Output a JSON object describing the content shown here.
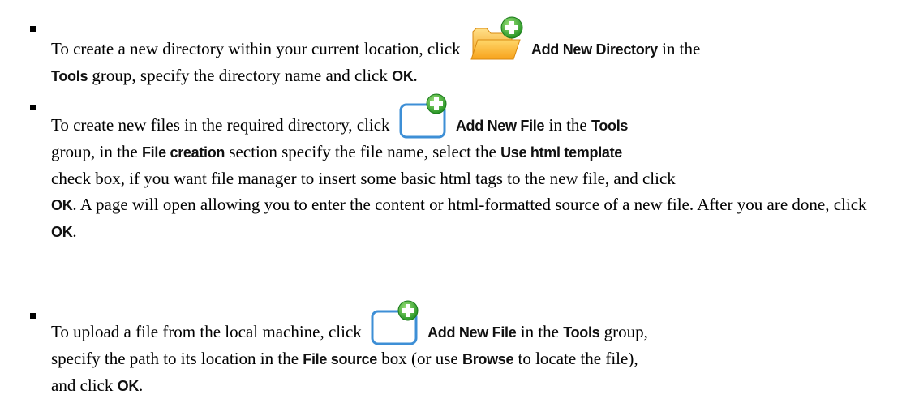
{
  "items": [
    {
      "segments": [
        "To create a new directory within your current location, click",
        "Add New Directory",
        "in the",
        "Tools",
        "group, specify the directory name and click",
        "OK",
        "."
      ],
      "icon": "add-folder-icon"
    },
    {
      "segments": [
        "To create new files in the required directory, click",
        "Add New File",
        "in the",
        "Tools",
        "group, in the",
        "File creation",
        "section specify the file name, select the",
        "Use html template",
        "check box, if you want file manager to insert some basic html tags to the new file, and click",
        "OK",
        ". A page will open allowing you to enter the content or html-formatted source of a new file. After you are done, click",
        "OK",
        "."
      ],
      "icon": "add-file-icon"
    },
    {
      "segments": [
        "To upload a file from the local machine, click",
        "Add New File",
        "in the",
        "Tools",
        "group, specify the path to its location in the",
        "File source",
        "box (or use",
        "Browse",
        "to locate the file), and click",
        "OK",
        "."
      ],
      "icon": "add-file-icon"
    }
  ],
  "colors": {
    "folder": "#f5a623",
    "folder_light": "#ffd36b",
    "plus_green": "#2fa82f",
    "file_border": "#3d8fd6"
  }
}
